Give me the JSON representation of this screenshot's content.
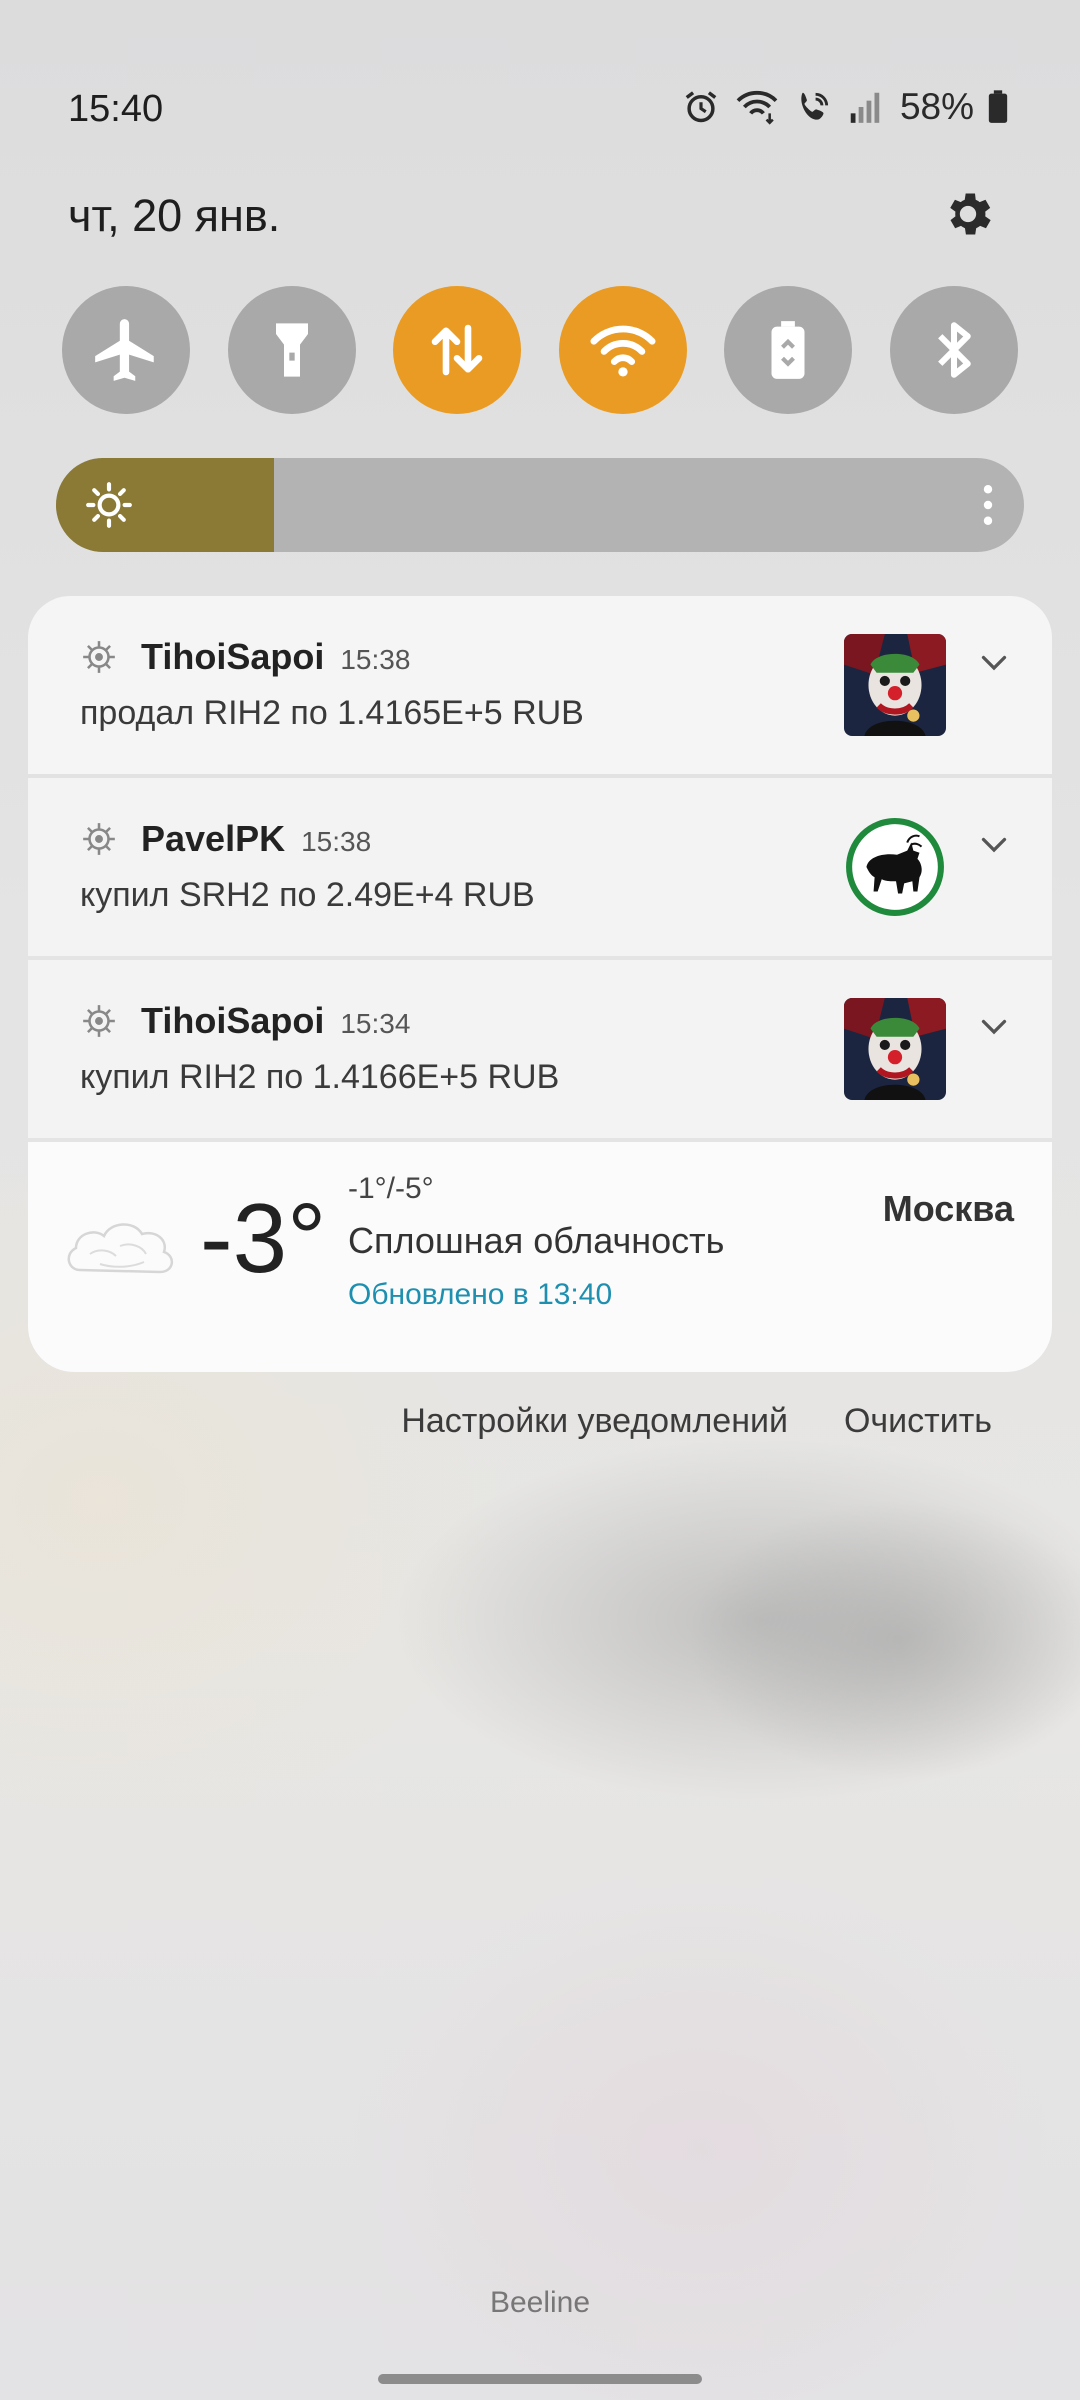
{
  "status_bar": {
    "time": "15:40",
    "battery": "58%",
    "icons": [
      "alarm-icon",
      "wifi-icon",
      "wifi-call-icon",
      "signal-icon",
      "battery-icon"
    ]
  },
  "header": {
    "date": "чт, 20 янв.",
    "settings_icon": "gear-icon"
  },
  "quick_settings": [
    {
      "name": "airplane-mode",
      "icon": "airplane-icon",
      "active": false
    },
    {
      "name": "flashlight",
      "icon": "flashlight-icon",
      "active": false
    },
    {
      "name": "mobile-data",
      "icon": "data-arrows-icon",
      "active": true
    },
    {
      "name": "wifi",
      "icon": "wifi-icon",
      "active": true
    },
    {
      "name": "power-saving",
      "icon": "battery-saver-icon",
      "active": false
    },
    {
      "name": "bluetooth",
      "icon": "bluetooth-icon",
      "active": false
    }
  ],
  "brightness": {
    "level": 0.225,
    "icon": "sun-icon"
  },
  "colors": {
    "accent": "#e99b23",
    "brightness_fill": "#8a7a35",
    "link": "#1f8fb0"
  },
  "notifications": [
    {
      "sender": "TihoiSapoi",
      "time": "15:38",
      "text": "продал RIH2 по 1.4165E+5 RUB",
      "thumb": "clown-avatar"
    },
    {
      "sender": "PavelPK",
      "time": "15:38",
      "text": "купил SRH2 по 2.49E+4 RUB",
      "thumb": "bull-avatar"
    },
    {
      "sender": "TihoiSapoi",
      "time": "15:34",
      "text": "купил RIH2 по 1.4166E+5 RUB",
      "thumb": "clown-avatar"
    }
  ],
  "weather": {
    "temp": "-3°",
    "range": "-1°/-5°",
    "condition": "Сплошная облачность",
    "updated": "Обновлено в 13:40",
    "city": "Москва"
  },
  "actions": {
    "settings_label": "Настройки уведомлений",
    "clear_label": "Очистить"
  },
  "carrier": "Beeline"
}
